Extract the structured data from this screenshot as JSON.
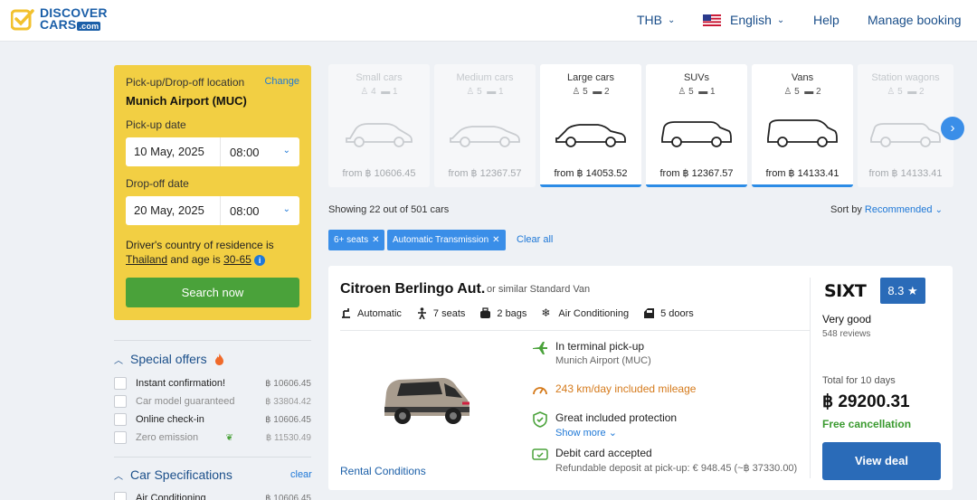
{
  "header": {
    "logo_line1": "DISCOVER",
    "logo_line2": "CARS",
    "logo_dotcom": ".com",
    "currency": "THB",
    "language": "English",
    "help": "Help",
    "manage_booking": "Manage booking"
  },
  "search": {
    "location_label": "Pick-up/Drop-off location",
    "change_label": "Change",
    "location": "Munich Airport (MUC)",
    "pickup_label": "Pick-up date",
    "pickup_date": "10 May, 2025",
    "pickup_time": "08:00",
    "dropoff_label": "Drop-off date",
    "dropoff_date": "20 May, 2025",
    "dropoff_time": "08:00",
    "country_text1": "Driver's country of residence is",
    "country": "Thailand",
    "country_text2": "and age is",
    "age": "30-65",
    "search_button": "Search now"
  },
  "filters": {
    "special_offers_title": "Special offers",
    "special_offers": [
      {
        "label": "Instant confirmation!",
        "price": "฿ 10606.45",
        "dim": false
      },
      {
        "label": "Car model guaranteed",
        "price": "฿ 33804.42",
        "dim": true
      },
      {
        "label": "Online check-in",
        "price": "฿ 10606.45",
        "dim": false
      },
      {
        "label": "Zero emission",
        "price": "฿ 11530.49",
        "dim": true
      }
    ],
    "car_specs_title": "Car Specifications",
    "clear_label": "clear",
    "car_specs": [
      {
        "label": "Air Conditioning",
        "price": "฿ 10606.45"
      }
    ]
  },
  "categories": [
    {
      "name": "Small cars",
      "seats": "4",
      "bags": "1",
      "price": "from ฿ 10606.45",
      "state": "dim"
    },
    {
      "name": "Medium cars",
      "seats": "5",
      "bags": "1",
      "price": "from ฿ 12367.57",
      "state": "dim"
    },
    {
      "name": "Large cars",
      "seats": "5",
      "bags": "2",
      "price": "from ฿ 14053.52",
      "state": "active"
    },
    {
      "name": "SUVs",
      "seats": "5",
      "bags": "1",
      "price": "from ฿ 12367.57",
      "state": "active"
    },
    {
      "name": "Vans",
      "seats": "5",
      "bags": "2",
      "price": "from ฿ 14133.41",
      "state": "active"
    },
    {
      "name": "Station wagons",
      "seats": "5",
      "bags": "2",
      "price": "from ฿ 14133.41",
      "state": "dim"
    }
  ],
  "results": {
    "showing": "Showing 22 out of 501 cars",
    "sort_label": "Sort by",
    "sort_value": "Recommended",
    "chips": [
      "6+ seats",
      "Automatic Transmission"
    ],
    "clear_all": "Clear all"
  },
  "card": {
    "title": "Citroen Berlingo Aut.",
    "similar": "or similar Standard Van",
    "specs": [
      "Automatic",
      "7 seats",
      "2 bags",
      "Air Conditioning",
      "5 doors"
    ],
    "rental_conditions": "Rental Conditions",
    "pickup_title": "In terminal pick-up",
    "pickup_sub": "Munich Airport (MUC)",
    "mileage": "243 km/day included mileage",
    "protection": "Great included protection",
    "show_more": "Show more",
    "debit_title": "Debit card accepted",
    "debit_sub": "Refundable deposit at pick-up: € 948.45 (~฿ 37330.00)",
    "supplier": "SIXT",
    "score": "8.3 ★",
    "rating_word": "Very good",
    "reviews": "548 reviews",
    "total_label": "Total for 10 days",
    "total_price": "฿ 29200.31",
    "free_cancellation": "Free cancellation",
    "view_deal": "View deal"
  },
  "colors": {
    "brand_blue": "#1b5fa8",
    "panel_yellow": "#f2cf43",
    "search_green": "#4aa23a",
    "link_blue": "#1e78d7",
    "orange": "#d57a1b"
  }
}
